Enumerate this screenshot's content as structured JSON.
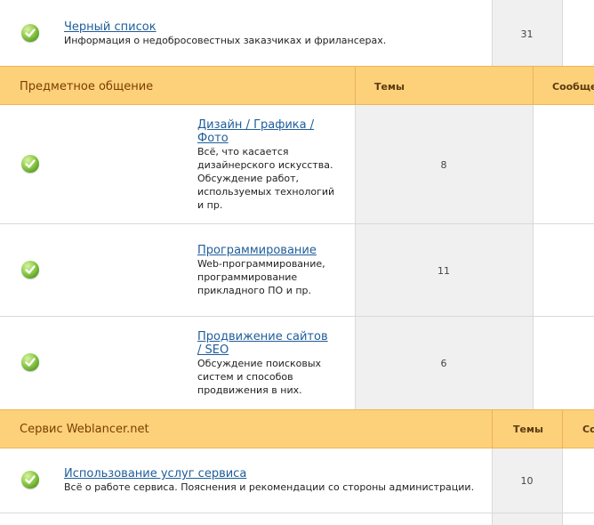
{
  "top_forum": {
    "title": "Черный список",
    "description": "Информация о недобросовестных заказчиках и фрилансерах.",
    "topics": "31"
  },
  "section1": {
    "title": "Предметное общение",
    "col_topics": "Темы",
    "col_messages": "Сообще",
    "forums": [
      {
        "title": "Дизайн / Графика / Фото",
        "description": "Всё, что касается дизайнерского искусства. Обсуждение работ, используемых технологий и пр.",
        "topics": "8"
      },
      {
        "title": "Программирование",
        "description": "Web-программирование, программирование прикладного ПО и пр.",
        "topics": "11"
      },
      {
        "title": "Продвижение сайтов / SEO",
        "description": "Обсуждение поисковых систем и способов продвижения в них.",
        "topics": "6"
      }
    ]
  },
  "section2": {
    "title": "Сервис Weblancer.net",
    "col_topics": "Темы",
    "col_messages": "Со",
    "forums": [
      {
        "title": "Использование услуг сервиса",
        "description": "Всё о работе сервиса. Пояснения и рекомендации со стороны администрации.",
        "topics": "10"
      }
    ]
  },
  "colors": {
    "header_bg": "#fdd17a",
    "header_text": "#7a3e00",
    "link": "#1f5d9a",
    "count_bg": "#f0f0f0"
  }
}
